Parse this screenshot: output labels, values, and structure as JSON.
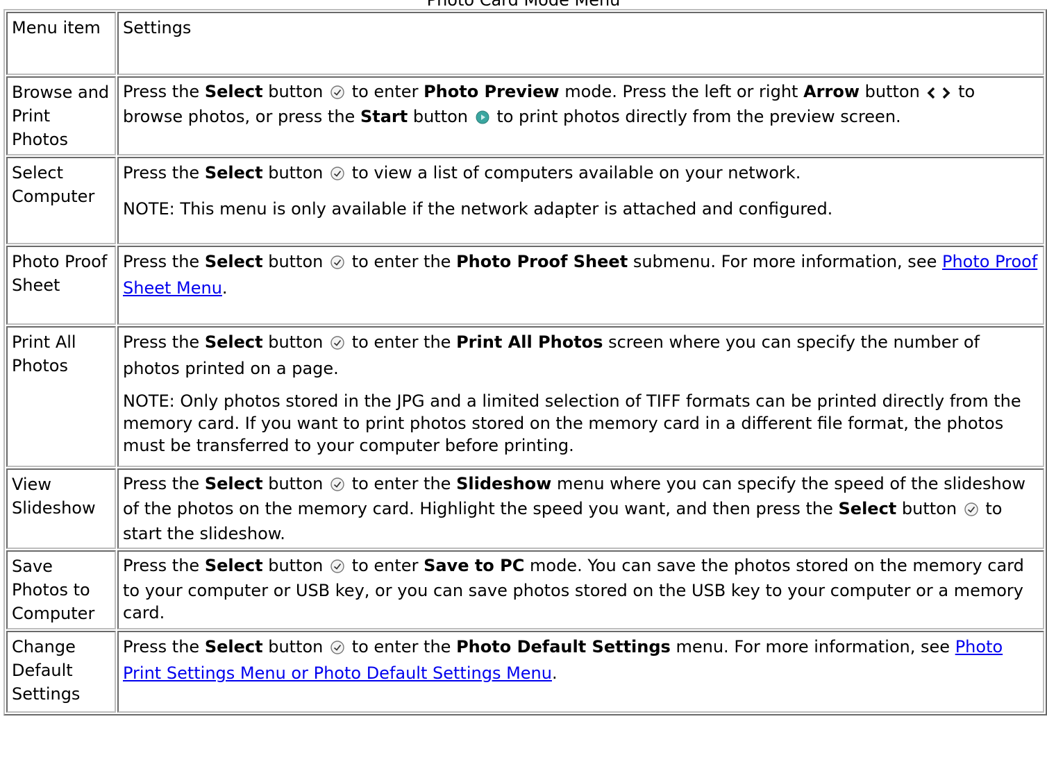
{
  "caption": "Photo Card Mode Menu",
  "header": {
    "item": "Menu item",
    "settings": "Settings"
  },
  "common": {
    "press_the": "Press the",
    "select": "Select",
    "button": "button",
    "note_prefix": "NOTE:",
    "for_more": "For more information, see"
  },
  "rows": [
    {
      "item": "Browse and Print Photos",
      "t1": "to enter",
      "b1": "Photo Preview",
      "t2": "mode. Press the left or right",
      "b2": "Arrow",
      "t3": "button",
      "t4": "to browse photos, or press the",
      "b3": "Start",
      "t5": "button",
      "t6": "to print photos directly from the preview screen."
    },
    {
      "item": "Select Computer",
      "t1": "to view a list of computers available on your network.",
      "note": "This menu is only available if the network adapter is attached and configured."
    },
    {
      "item": "Photo Proof Sheet",
      "t1": "to enter the",
      "b1": "Photo Proof Sheet",
      "t2": "submenu.",
      "link": "Photo Proof Sheet Menu"
    },
    {
      "item": "Print All Photos",
      "t1": "to enter the",
      "b1": "Print All Photos",
      "t2": "screen where you can specify the number of photos printed on a page.",
      "note": "Only photos stored in the JPG and a limited selection of TIFF formats can be printed directly from the memory card. If you want to print photos stored on the memory card in a different file format, the photos must be transferred to your computer before printing."
    },
    {
      "item": "View Slideshow",
      "t1": "to enter the",
      "b1": "Slideshow",
      "t2": "menu where you can specify the speed of the slideshow of the photos on the memory card. Highlight the speed you want, and then press the",
      "t3": "to start the slideshow."
    },
    {
      "item": "Save Photos to Computer",
      "t1": "to enter",
      "b1": "Save to PC",
      "t2": "mode. You can save the photos stored on the memory card to your computer or USB key, or you can save photos stored on the USB key to your computer or a memory card."
    },
    {
      "item": "Change Default Settings",
      "t1": "to enter the",
      "b1": "Photo Default Settings",
      "t2": "menu.",
      "link": "Photo Print Settings Menu or Photo Default Settings Menu"
    }
  ],
  "colors": {
    "link": "#0000ee",
    "start_icon": "#3aa6a0",
    "border": "#bdbdbd"
  },
  "icons": [
    "select-check-icon",
    "left-arrow-icon",
    "right-arrow-icon",
    "start-button-icon"
  ]
}
